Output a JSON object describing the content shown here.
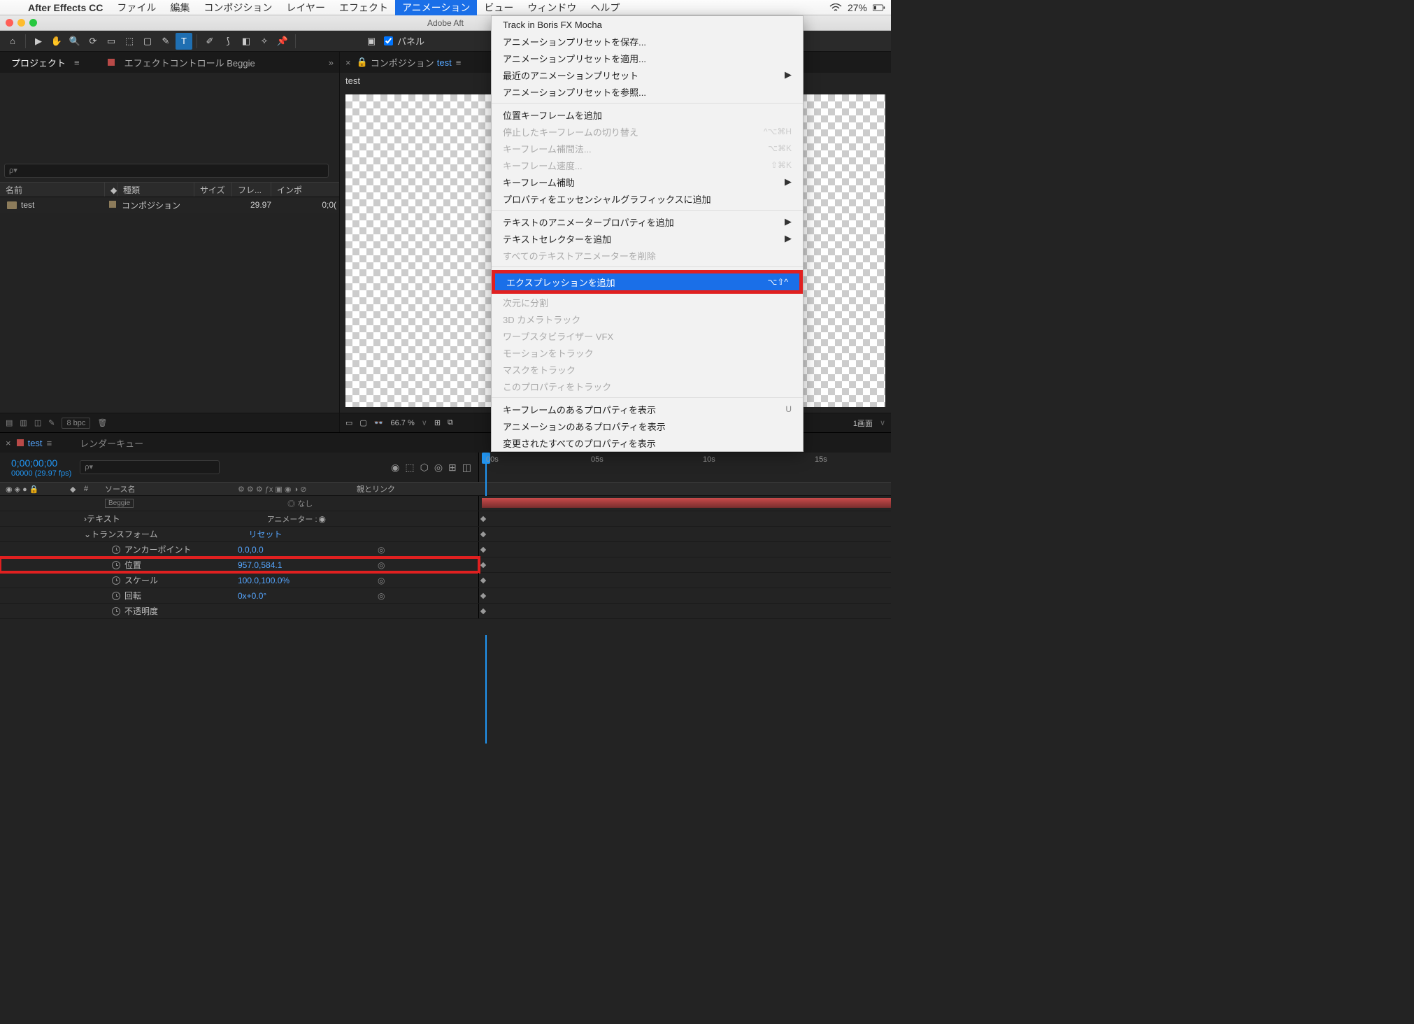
{
  "menubar": {
    "app": "After Effects CC",
    "items": [
      "ファイル",
      "編集",
      "コンポジション",
      "レイヤー",
      "エフェクト",
      "アニメーション",
      "ビュー",
      "ウィンドウ",
      "ヘルプ"
    ],
    "active_index": 5,
    "battery_pct": "27%"
  },
  "window": {
    "title": "Adobe Aft"
  },
  "toolbar_panel_label": "パネル",
  "project": {
    "tab_project": "プロジェクト",
    "tab_effects": "エフェクトコントロール Beggie",
    "search_placeholder": "ρ▾",
    "cols": {
      "name": "名前",
      "tag": "",
      "type": "種類",
      "size": "サイズ",
      "fps": "フレ...",
      "in": "インポ"
    },
    "row": {
      "name": "test",
      "type": "コンポジション",
      "fps": "29.97",
      "in": "0;0("
    },
    "footer_bpc": "8 bpc"
  },
  "comp": {
    "panel_label": "コンポジション",
    "name": "test",
    "tab": "test",
    "zoom": "66.7 %",
    "view_mode": "1画面"
  },
  "timeline": {
    "tab": "test",
    "render_tab": "レンダーキュー",
    "timecode": "0;00;00;00",
    "sub": "00000 (29.97 fps)",
    "col_source": "ソース名",
    "col_parent": "親とリンク",
    "ruler": [
      "00s",
      "05s",
      "10s",
      "15s"
    ],
    "rows": {
      "beggie": "Beggie",
      "text": "テキスト",
      "animator": "アニメーター :",
      "transform": "トランスフォーム",
      "reset": "リセット",
      "anchor": "アンカーポイント",
      "anchor_v": "0.0,0.0",
      "position": "位置",
      "position_v": "957.0,584.1",
      "scale": "スケール",
      "scale_v": "100.0,100.0%",
      "rotation": "回転",
      "rotation_v": "0x+0.0°",
      "opacity": "不透明度"
    }
  },
  "dropdown": {
    "items": [
      {
        "label": "Track in Boris FX Mocha",
        "enabled": true
      },
      {
        "label": "アニメーションプリセットを保存...",
        "enabled": true
      },
      {
        "label": "アニメーションプリセットを適用...",
        "enabled": true
      },
      {
        "label": "最近のアニメーションプリセット",
        "enabled": true,
        "sub": true
      },
      {
        "label": "アニメーションプリセットを参照...",
        "enabled": true
      },
      {
        "sep": true
      },
      {
        "label": "位置キーフレームを追加",
        "enabled": true
      },
      {
        "label": "停止したキーフレームの切り替え",
        "enabled": false,
        "sc": "^⌥⌘H"
      },
      {
        "label": "キーフレーム補間法...",
        "enabled": false,
        "sc": "⌥⌘K"
      },
      {
        "label": "キーフレーム速度...",
        "enabled": false,
        "sc": "⇧⌘K"
      },
      {
        "label": "キーフレーム補助",
        "enabled": true,
        "sub": true
      },
      {
        "label": "プロパティをエッセンシャルグラフィックスに追加",
        "enabled": true
      },
      {
        "sep": true
      },
      {
        "label": "テキストのアニメータープロパティを追加",
        "enabled": true,
        "sub": true
      },
      {
        "label": "テキストセレクターを追加",
        "enabled": true,
        "sub": true
      },
      {
        "label": "すべてのテキストアニメーターを削除",
        "enabled": false
      },
      {
        "sep": true
      },
      {
        "label": "エクスプレッションを追加",
        "enabled": true,
        "sc": "⌥⇧^",
        "hl": true,
        "red": true
      },
      {
        "label": "次元に分割",
        "enabled": false
      },
      {
        "label": "3D カメラトラック",
        "enabled": false
      },
      {
        "label": "ワープスタビライザー VFX",
        "enabled": false
      },
      {
        "label": "モーションをトラック",
        "enabled": false
      },
      {
        "label": "マスクをトラック",
        "enabled": false
      },
      {
        "label": "このプロパティをトラック",
        "enabled": false
      },
      {
        "sep": true
      },
      {
        "label": "キーフレームのあるプロパティを表示",
        "enabled": true,
        "sc": "U"
      },
      {
        "label": "アニメーションのあるプロパティを表示",
        "enabled": true
      },
      {
        "label": "変更されたすべてのプロパティを表示",
        "enabled": true
      }
    ]
  }
}
